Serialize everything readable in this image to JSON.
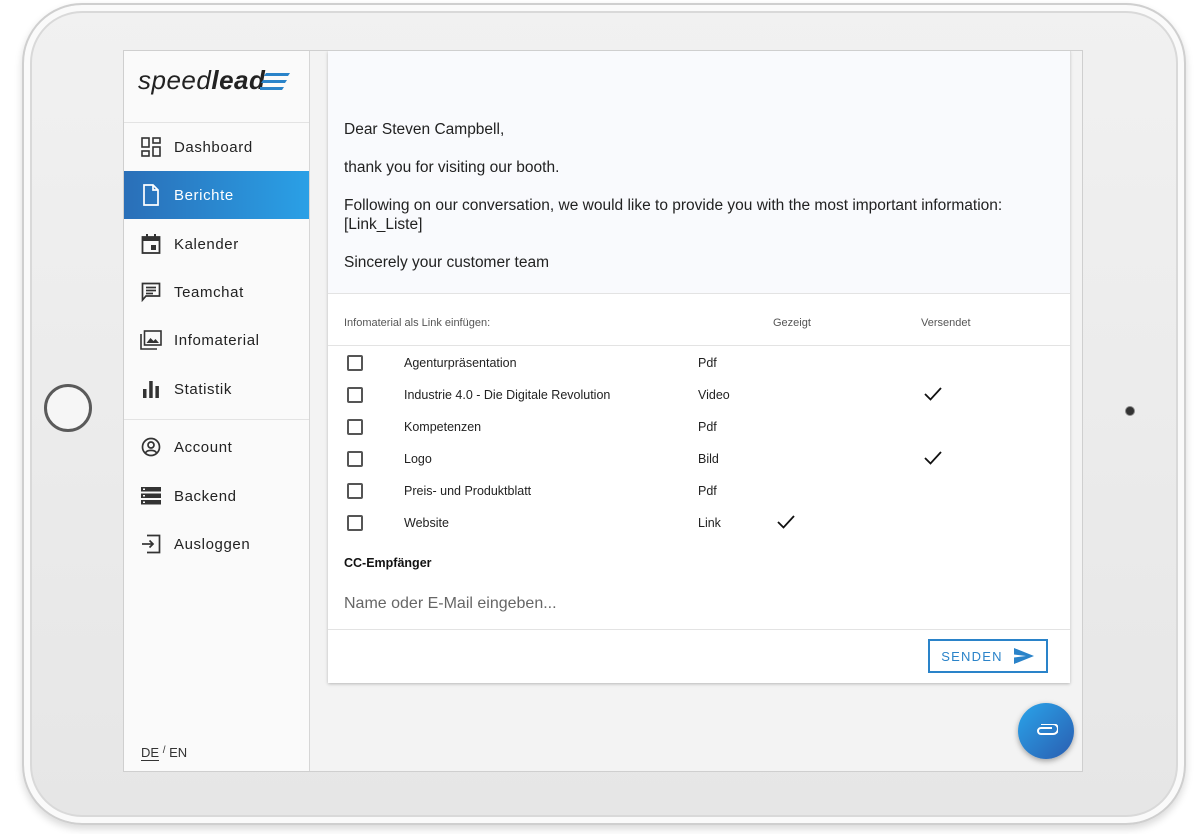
{
  "logo": {
    "prefix": "speed",
    "suffix": "lead"
  },
  "sidebar": {
    "items": [
      {
        "label": "Dashboard",
        "icon": "dashboard-icon"
      },
      {
        "label": "Berichte",
        "icon": "document-icon",
        "active": true
      },
      {
        "label": "Kalender",
        "icon": "calendar-icon"
      },
      {
        "label": "Teamchat",
        "icon": "chat-icon"
      },
      {
        "label": "Infomaterial",
        "icon": "photo-library-icon"
      },
      {
        "label": "Statistik",
        "icon": "bar-chart-icon"
      }
    ],
    "secondary": [
      {
        "label": "Account",
        "icon": "account-icon"
      },
      {
        "label": "Backend",
        "icon": "server-icon"
      },
      {
        "label": "Ausloggen",
        "icon": "logout-icon"
      }
    ],
    "lang": {
      "de": "DE",
      "sep": "/",
      "en": "EN"
    }
  },
  "letter": {
    "greeting": "Dear Steven Campbell,",
    "line1": "thank you for visiting our booth.",
    "line2": "Following on our conversation, we would like to provide you with the most important information:",
    "line3": "[Link_Liste]",
    "closing": "Sincerely your customer team"
  },
  "table": {
    "headers": {
      "material": "Infomaterial als Link einfügen:",
      "shown": "Gezeigt",
      "sent": "Versendet"
    },
    "rows": [
      {
        "name": "Agenturpräsentation",
        "type": "Pdf",
        "shown": false,
        "sent": false
      },
      {
        "name": "Industrie 4.0 - Die Digitale Revolution",
        "type": "Video",
        "shown": false,
        "sent": true
      },
      {
        "name": "Kompetenzen",
        "type": "Pdf",
        "shown": false,
        "sent": false
      },
      {
        "name": "Logo",
        "type": "Bild",
        "shown": false,
        "sent": true
      },
      {
        "name": "Preis- und Produktblatt",
        "type": "Pdf",
        "shown": false,
        "sent": false
      },
      {
        "name": "Website",
        "type": "Link",
        "shown": true,
        "sent": false
      }
    ]
  },
  "cc": {
    "label": "CC-Empfänger",
    "placeholder": "Name oder E-Mail eingeben..."
  },
  "send": {
    "label": "SENDEN"
  },
  "colors": {
    "accent": "#2a83c9",
    "active_start": "#2a6fb8",
    "active_end": "#2aa0e6"
  }
}
